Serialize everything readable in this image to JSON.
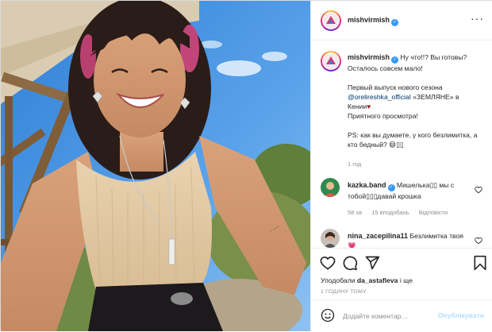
{
  "post": {
    "author": "mishvirmish",
    "verified": true,
    "more_icon": "more-horizontal-icon",
    "caption_author": "mishvirmish",
    "caption_lines": [
      "Ну что!!? Вы готовы? Осталось совсем мало!",
      "Первый выпуск нового сезона",
      "@orelireshka_official",
      "«ЗЕМЛЯНЕ» в Кении",
      "Приятного просмотра!",
      "PS: как вы думаете, у кого безлимитка, а кто бедный? 😄▯▯"
    ],
    "caption_time": "1 год"
  },
  "comments": [
    {
      "author": "kazka.band",
      "verified": true,
      "text": "Мишелька▯▯ мы с тобой▯▯▯давай крошка",
      "time": "58 хв",
      "likes": "15 вподобань",
      "reply": "Відповісти"
    },
    {
      "author": "nina_zacepilina11",
      "verified": false,
      "text": "Безлимитка твоя",
      "emoji": "💗"
    }
  ],
  "actions": {
    "like_icon": "heart-icon",
    "comment_icon": "comment-icon",
    "share_icon": "share-icon",
    "save_icon": "bookmark-icon",
    "liked_by_prefix": "Уподобали",
    "liked_by_user": "da_astafleva",
    "liked_by_suffix": "і ще",
    "post_time": "1 ГОДИНУ ТОМУ"
  },
  "add_comment": {
    "emoji_icon": "smiley-icon",
    "placeholder": "Додайте коментар…",
    "publish_label": "Опублікувати"
  },
  "colors": {
    "verified": "#3897f0",
    "link": "#00376b",
    "muted": "#8e8e8e",
    "publish_disabled": "#b2dffc"
  }
}
